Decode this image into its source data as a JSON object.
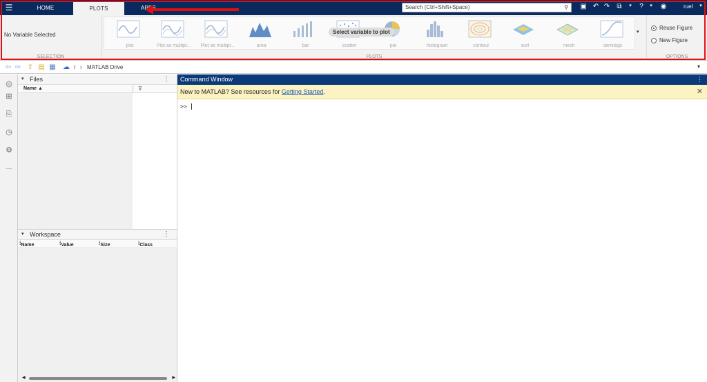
{
  "topbar": {
    "tabs": [
      {
        "label": "HOME"
      },
      {
        "label": "PLOTS"
      },
      {
        "label": "APPS"
      }
    ],
    "search_placeholder": "Search (Ctrl+Shift+Space)",
    "user": "ruel"
  },
  "ribbon": {
    "selection": {
      "no_variable": "No Variable Selected",
      "label": "SELECTION"
    },
    "plots": {
      "label": "PLOTS",
      "tooltip": "Select variable to plot",
      "items": [
        {
          "label": "plot",
          "icon": "line-plot-icon"
        },
        {
          "label": "Plot as multipl...",
          "icon": "multi-line-plot-icon"
        },
        {
          "label": "Plot as multipl...",
          "icon": "multi-line-plot-icon"
        },
        {
          "label": "area",
          "icon": "area-plot-icon"
        },
        {
          "label": "bar",
          "icon": "bar-plot-icon"
        },
        {
          "label": "scatter",
          "icon": "scatter-plot-icon"
        },
        {
          "label": "pie",
          "icon": "pie-plot-icon"
        },
        {
          "label": "histogram",
          "icon": "histogram-icon"
        },
        {
          "label": "contour",
          "icon": "contour-icon"
        },
        {
          "label": "surf",
          "icon": "surf-icon"
        },
        {
          "label": "mesh",
          "icon": "mesh-icon"
        },
        {
          "label": "semilogx",
          "icon": "semilogx-icon"
        }
      ]
    },
    "options": {
      "label": "OPTIONS",
      "reuse_figure": "Reuse Figure",
      "new_figure": "New Figure"
    }
  },
  "address": {
    "separator": "/",
    "path": "MATLAB Drive"
  },
  "files": {
    "title": "Files",
    "col_name": "Name ▲"
  },
  "workspace": {
    "title": "Workspace",
    "columns": [
      "Name",
      "Value",
      "Size",
      "Class"
    ]
  },
  "command_window": {
    "title": "Command Window",
    "banner_text": "New to MATLAB? See resources for ",
    "banner_link": "Getting Started",
    "banner_end": ".",
    "prompt": ">>"
  },
  "colors": {
    "topbar": "#0a2a5e",
    "annotation": "#e01010",
    "banner": "#fdf3c2"
  }
}
